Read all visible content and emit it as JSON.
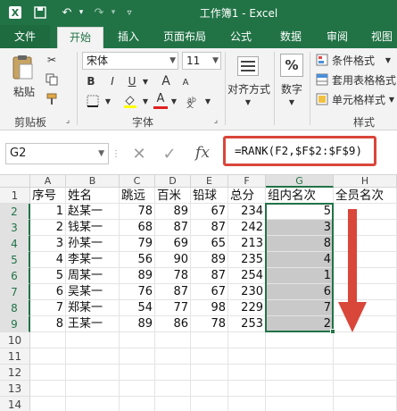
{
  "window": {
    "title": "工作簿1 - Excel"
  },
  "tabs": [
    "文件",
    "开始",
    "插入",
    "页面布局",
    "公式",
    "数据",
    "审阅",
    "视图"
  ],
  "ribbon": {
    "clipboard": {
      "paste_label": "粘贴",
      "group_label": "剪贴板"
    },
    "font": {
      "font_name": "宋体",
      "font_size": "11",
      "bold": "B",
      "italic": "I",
      "underline": "U",
      "grow": "A",
      "shrink": "A",
      "font_color": "A",
      "group_label": "字体"
    },
    "alignment": {
      "label": "对齐方式"
    },
    "number": {
      "label": "数字",
      "percent": "%"
    },
    "styles": {
      "conditional": "条件格式",
      "table": "套用表格格式",
      "cell": "单元格样式",
      "group_label": "样式"
    }
  },
  "formula_bar": {
    "name_box": "G2",
    "fx": "fx",
    "formula": "=RANK(F2,$F$2:$F$9)"
  },
  "grid": {
    "columns": [
      "A",
      "B",
      "C",
      "D",
      "E",
      "F",
      "G",
      "H"
    ],
    "rows": [
      "1",
      "2",
      "3",
      "4",
      "5",
      "6",
      "7",
      "8",
      "9",
      "10",
      "11",
      "12",
      "13",
      "14"
    ],
    "headers": [
      "序号",
      "姓名",
      "跳远",
      "百米",
      "铅球",
      "总分",
      "组内名次",
      "全员名次"
    ],
    "data": [
      [
        "1",
        "赵某一",
        "78",
        "89",
        "67",
        "234",
        "5",
        ""
      ],
      [
        "2",
        "钱某一",
        "68",
        "87",
        "87",
        "242",
        "3",
        ""
      ],
      [
        "3",
        "孙某一",
        "79",
        "69",
        "65",
        "213",
        "8",
        ""
      ],
      [
        "4",
        "李某一",
        "56",
        "90",
        "89",
        "235",
        "4",
        ""
      ],
      [
        "5",
        "周某一",
        "89",
        "78",
        "87",
        "254",
        "1",
        ""
      ],
      [
        "6",
        "吴某一",
        "76",
        "87",
        "67",
        "230",
        "6",
        ""
      ],
      [
        "7",
        "郑某一",
        "54",
        "77",
        "98",
        "229",
        "7",
        ""
      ],
      [
        "8",
        "王某一",
        "89",
        "86",
        "78",
        "253",
        "2",
        ""
      ]
    ],
    "selected_range": "G2:G9",
    "active_cell": "G2"
  },
  "colors": {
    "accent": "#217346",
    "annotation_red": "#d9463a",
    "selection_fill": "#c9c9c9"
  }
}
